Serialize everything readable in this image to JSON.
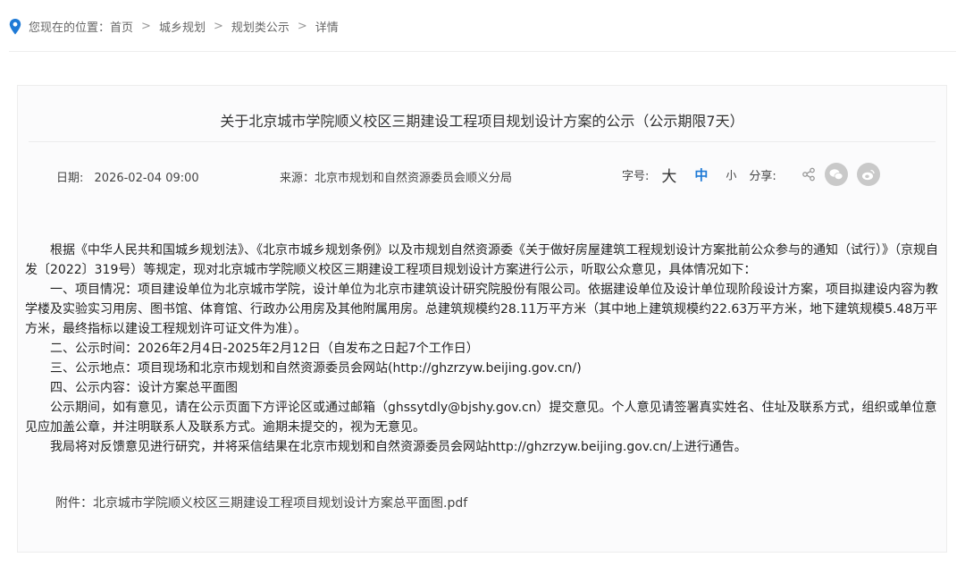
{
  "breadcrumb": {
    "prefix": "您现在的位置：",
    "items": [
      "首页",
      "城乡规划",
      "规划类公示",
      "详情"
    ],
    "separator": ">"
  },
  "article": {
    "title": "关于北京城市学院顺义校区三期建设工程项目规划设计方案的公示（公示期限7天）",
    "date_label": "日期:",
    "date_value": "2026-02-04 09:00",
    "source_label": "来源：",
    "source_value": "北京市规划和自然资源委员会顺义分局",
    "fontsize_label": "字号:",
    "fontsize_large": "大",
    "fontsize_medium": "中",
    "fontsize_small": "小",
    "share_label": "分享:",
    "paragraphs": [
      "根据《中华人民共和国城乡规划法》、《北京市城乡规划条例》以及市规划自然资源委《关于做好房屋建筑工程规划设计方案批前公众参与的通知（试行）》（京规自发〔2022〕319号）等规定，现对北京城市学院顺义校区三期建设工程项目规划设计方案进行公示，听取公众意见，具体情况如下：",
      "一、项目情况：项目建设单位为北京城市学院，设计单位为北京市建筑设计研究院股份有限公司。依据建设单位及设计单位现阶段设计方案，项目拟建设内容为教学楼及实验实习用房、图书馆、体育馆、行政办公用房及其他附属用房。总建筑规模约28.11万平方米（其中地上建筑规模约22.63万平方米，地下建筑规模5.48万平方米，最终指标以建设工程规划许可证文件为准）。",
      "二、公示时间：2026年2月4日-2025年2月12日（自发布之日起7个工作日）",
      "三、公示地点：项目现场和北京市规划和自然资源委员会网站(http://ghzrzyw.beijing.gov.cn/)",
      "四、公示内容：设计方案总平面图",
      "公示期间，如有意见，请在公示页面下方评论区或通过邮箱（ghssytdly@bjshy.gov.cn）提交意见。个人意见请签署真实姓名、住址及联系方式，组织或单位意见应加盖公章，并注明联系人及联系方式。逾期未提交的，视为无意见。",
      "我局将对反馈意见进行研究，并将采信结果在北京市规划和自然资源委员会网站http://ghzrzyw.beijing.gov.cn/上进行通告。"
    ],
    "attachment": "附件：北京城市学院顺义校区三期建设工程项目规划设计方案总平面图.pdf"
  },
  "colors": {
    "accent": "#1f7ad6",
    "pin": "#1f7ad6",
    "share_icon_bg": "#c9c9c9"
  },
  "icons": {
    "location": "location-pin-icon",
    "share": "share-icon",
    "wechat": "wechat-icon",
    "weibo": "weibo-icon"
  }
}
